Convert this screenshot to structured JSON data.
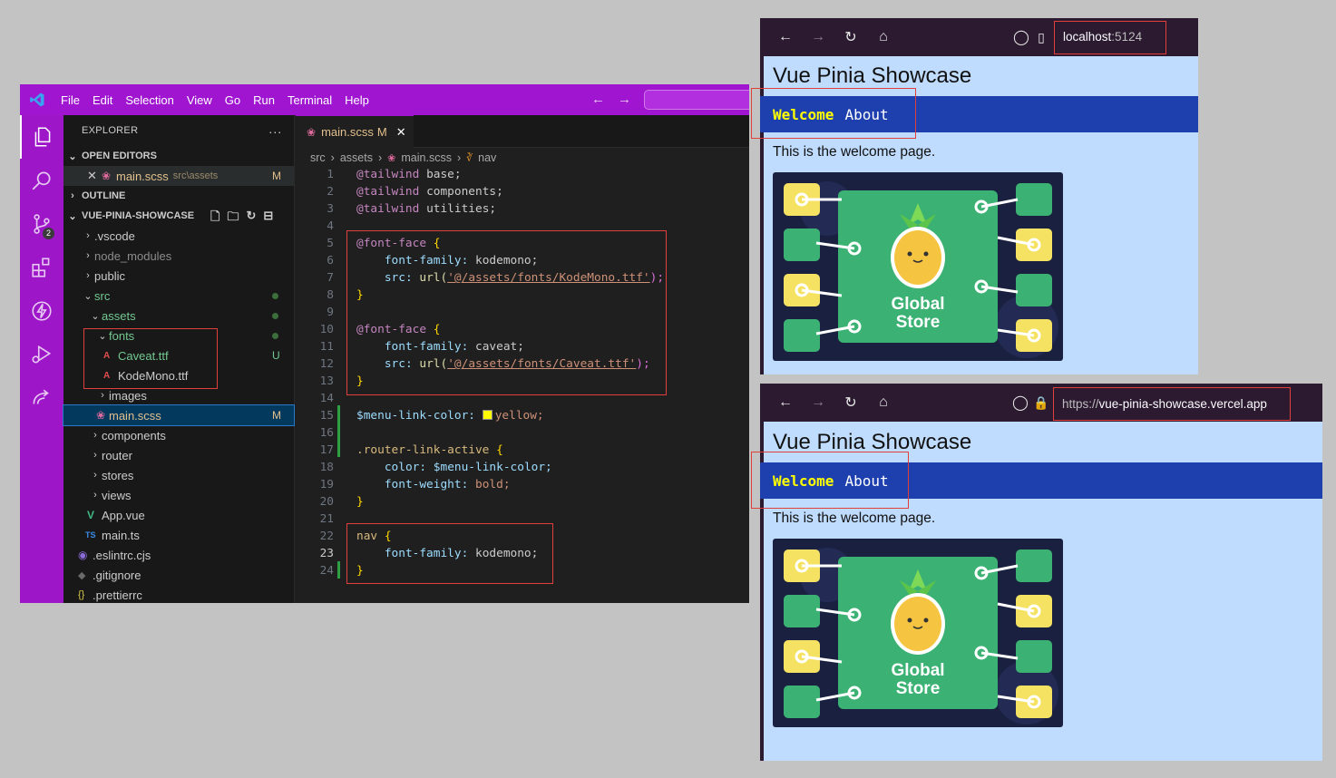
{
  "vscode": {
    "menu": [
      "File",
      "Edit",
      "Selection",
      "View",
      "Go",
      "Run",
      "Terminal",
      "Help"
    ],
    "scm_badge": "2",
    "explorer_title": "EXPLORER",
    "open_editors_label": "OPEN EDITORS",
    "open_editor_file": "main.scss",
    "open_editor_path": "src\\assets",
    "open_editor_status": "M",
    "outline_label": "OUTLINE",
    "project_label": "VUE-PINIA-SHOWCASE",
    "tree": [
      {
        "name": ".vscode",
        "status": ""
      },
      {
        "name": "node_modules",
        "status": ""
      },
      {
        "name": "public",
        "status": ""
      },
      {
        "name": "src",
        "status": ""
      },
      {
        "name": "assets",
        "status": ""
      },
      {
        "name": "fonts",
        "status": ""
      },
      {
        "name": "Caveat.ttf",
        "status": "U"
      },
      {
        "name": "KodeMono.ttf",
        "status": ""
      },
      {
        "name": "images",
        "status": ""
      },
      {
        "name": "main.scss",
        "status": "M"
      },
      {
        "name": "components",
        "status": ""
      },
      {
        "name": "router",
        "status": ""
      },
      {
        "name": "stores",
        "status": ""
      },
      {
        "name": "views",
        "status": ""
      },
      {
        "name": "App.vue",
        "status": ""
      },
      {
        "name": "main.ts",
        "status": ""
      },
      {
        "name": ".eslintrc.cjs",
        "status": ""
      },
      {
        "name": ".gitignore",
        "status": ""
      },
      {
        "name": ".prettierrc",
        "status": ""
      }
    ],
    "tab_label": "main.scss",
    "tab_status": "M",
    "breadcrumb": [
      "src",
      "assets",
      "main.scss",
      "nav"
    ],
    "line_numbers": [
      "1",
      "2",
      "3",
      "4",
      "5",
      "6",
      "7",
      "8",
      "9",
      "10",
      "11",
      "12",
      "13",
      "14",
      "15",
      "16",
      "17",
      "18",
      "19",
      "20",
      "21",
      "22",
      "23",
      "24"
    ],
    "code": {
      "l1_kw": "@tailwind",
      "l1_v": "base;",
      "l2_kw": "@tailwind",
      "l2_v": "components;",
      "l3_kw": "@tailwind",
      "l3_v": "utilities;",
      "l5_kw": "@font-face",
      "l5_b": "{",
      "l6_p": "font-family:",
      "l6_v": "kodemono;",
      "l7_p": "src:",
      "l7_fn": "url(",
      "l7_s": "'@/assets/fonts/KodeMono.ttf'",
      "l7_e": ");",
      "l8_b": "}",
      "l10_kw": "@font-face",
      "l10_b": "{",
      "l11_p": "font-family:",
      "l11_v": "caveat;",
      "l12_p": "src:",
      "l12_fn": "url(",
      "l12_s": "'@/assets/fonts/Caveat.ttf'",
      "l12_e": ");",
      "l13_b": "}",
      "l15_var": "$menu-link-color:",
      "l15_v": "yellow;",
      "l17_sel": ".router-link-active",
      "l17_b": "{",
      "l18_p": "color:",
      "l18_v": "$menu-link-color;",
      "l19_p": "font-weight:",
      "l19_v": "bold;",
      "l20_b": "}",
      "l22_sel": "nav",
      "l22_b": "{",
      "l23_p": "font-family:",
      "l23_v": "kodemono;",
      "l24_b": "}"
    }
  },
  "browser_local": {
    "url_host": "localhost",
    "url_port": ":5124",
    "title": "Vue Pinia Showcase",
    "nav_active": "Welcome",
    "nav_link": "About",
    "text": "This is the welcome page.",
    "hero_text_1": "Global",
    "hero_text_2": "Store"
  },
  "browser_prod": {
    "url_prefix": "https://",
    "url_host": "vue-pinia-showcase.vercel.app",
    "title": "Vue Pinia Showcase",
    "nav_active": "Welcome",
    "nav_link": "About",
    "text": "This is the welcome page.",
    "hero_text_1": "Global",
    "hero_text_2": "Store"
  }
}
